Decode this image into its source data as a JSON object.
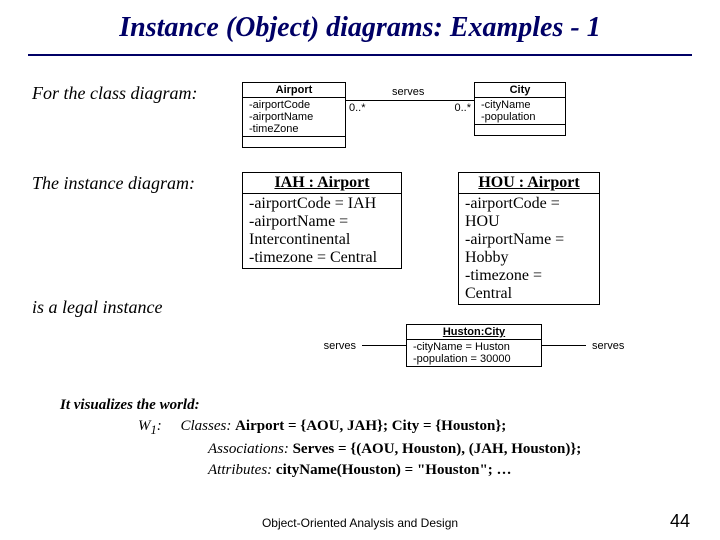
{
  "title": "Instance (Object) diagrams: Examples - 1",
  "lead1": "For the class diagram:",
  "lead2": "The instance diagram:",
  "legal": "is a legal instance",
  "class_diagram": {
    "airport": {
      "name": "Airport",
      "a1": "-airportCode",
      "a2": "-airportName",
      "a3": "-timeZone"
    },
    "assoc": {
      "label": "serves",
      "m1": "0..*",
      "m2": "0..*"
    },
    "city": {
      "name": "City",
      "a1": "-cityName",
      "a2": "-population"
    }
  },
  "instance_diagram": {
    "iah": {
      "name": "IAH : Airport",
      "l1": "-airportCode = IAH",
      "l2": "-airportName = Intercontinental",
      "l3": "-timezone = Central"
    },
    "hou": {
      "name": "HOU : Airport",
      "l1": "-airportCode = HOU",
      "l2": "-airportName = Hobby",
      "l3": "-timezone = Central"
    },
    "huston": {
      "name": "Huston:City",
      "l1": "-cityName = Huston",
      "l2": "-population = 30000"
    },
    "serves": "serves"
  },
  "world": {
    "hdr": "It visualizes the world:",
    "w1": "W",
    "sub": "1",
    "colon": ": ",
    "classes_label": "Classes: ",
    "classes_val": "Airport = {AOU, JAH}; City = {Houston};",
    "assoc_label": "Associations: ",
    "assoc_val": "Serves = {(AOU, Houston), (JAH, Houston)};",
    "attr_label": "Attributes:  ",
    "attr_val": "cityName(Houston) = \"Houston\"; …"
  },
  "footer": "Object-Oriented Analysis and Design",
  "pagenum": "44"
}
